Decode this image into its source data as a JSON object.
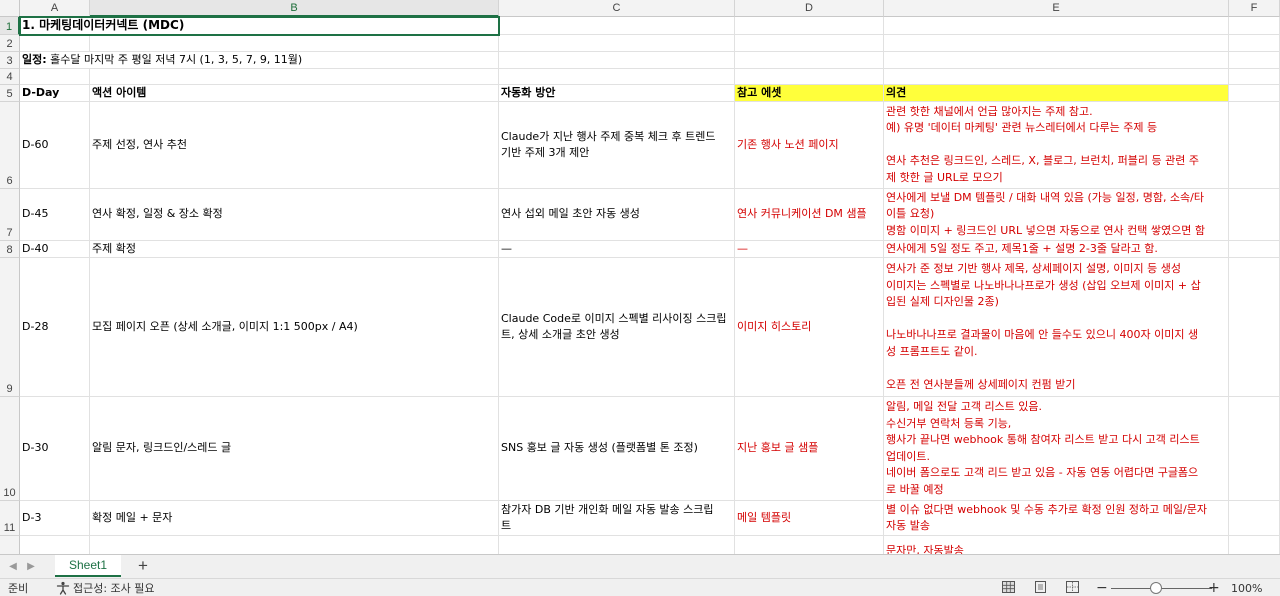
{
  "columns": [
    "A",
    "B",
    "C",
    "D",
    "E",
    "F"
  ],
  "rows": [
    "1",
    "2",
    "3",
    "4",
    "5",
    "6",
    "7",
    "8",
    "9",
    "10",
    "11"
  ],
  "title": "1. 마케팅데이터커넥트 (MDC)",
  "schedule": {
    "label": "일정:",
    "text": " 홀수달 마지막 주 평일 저녁 7시 (1, 3, 5, 7, 9, 11월)"
  },
  "headers": {
    "dday": "D-Day",
    "action": "액션 아이템",
    "automation": "자동화 방안",
    "asset": "참고 에셋",
    "opinion": "의견"
  },
  "data_rows": [
    {
      "dday": "D-60",
      "action": "주제 선정, 연사 추천",
      "automation": "Claude가 지난 행사 주제 중복 체크 후 트렌드\n기반 주제 3개 제안",
      "asset": "기존 행사 노션 페이지",
      "opinion": "관련 핫한 채널에서 언급 많아지는 주제 참고.\n예) 유명 '데이터 마케팅' 관련 뉴스레터에서 다루는 주제 등\n\n연사 추천은 링크드인, 스레드, X, 블로그, 브런치, 퍼블리 등 관련 주\n제 핫한 글 URL로 모으기"
    },
    {
      "dday": "D-45",
      "action": "연사 확정, 일정 & 장소 확정",
      "automation": "연사 섭외 메일 초안 자동 생성",
      "asset": "연사 커뮤니케이션 DM 샘플",
      "opinion": "연사에게 보낼 DM 템플릿 / 대화 내역 있음 (가능 일정, 명함, 소속/타\n이틀 요청)\n명함 이미지 + 링크드인 URL 넣으면 자동으로 연사 컨택 쌓였으면 함"
    },
    {
      "dday": "D-40",
      "action": "주제 확정",
      "automation": "—",
      "asset": "—",
      "opinion": "연사에게 5일 정도 주고, 제목1줄 + 설명 2-3줄 달라고 함."
    },
    {
      "dday": "D-28",
      "action": "모집 페이지 오픈 (상세 소개글, 이미지 1:1 500px / A4)",
      "automation": "Claude Code로 이미지 스펙별 리사이징 스크립\n트, 상세 소개글 초안 생성",
      "asset": "이미지 히스토리",
      "opinion": "연사가 준 정보 기반 행사 제목, 상세페이지 설명, 이미지 등 생성\n이미지는 스펙별로 나노바나나프로가 생성 (삽입 오브제 이미지 + 삽\n입된 실제 디자인물 2종)\n\n나노바나나프로 결과물이 마음에 안 들수도 있으니 400자 이미지 생\n성 프롬프트도 같이.\n\n오픈 전 연사분들께 상세페이지 컨펌 받기"
    },
    {
      "dday": "D-30",
      "action": "알림 문자, 링크드인/스레드 글",
      "automation": "SNS 홍보 글 자동 생성 (플랫폼별 톤 조정)",
      "asset": "지난 홍보 글 샘플",
      "opinion": "알림, 메일 전달 고객 리스트 있음.\n수신거부 연락처 등록 기능,\n행사가 끝나면 webhook 통해 참여자 리스트 받고 다시 고객 리스트\n업데이트.\n네이버 폼으로도 고객 리드 받고 있음 - 자동 연동 어렵다면 구글폼으\n로 바꿀 예정"
    },
    {
      "dday": "D-3",
      "action": "확정 메일 + 문자",
      "automation": "참가자 DB 기반 개인화 메일 자동 발송 스크립\n트",
      "asset": "메일 템플릿",
      "opinion": "별 이슈 없다면 webhook 및 수동 추가로 확정 인원 정하고 메일/문자\n자동 발송"
    },
    {
      "dday": "",
      "action": "",
      "automation": "",
      "asset": "",
      "opinion": "문자만, 자동발송"
    }
  ],
  "sheet_tab": "Sheet1",
  "add_sheet": "+",
  "status": {
    "ready": "준비",
    "accessibility": "접근성: 조사 필요",
    "zoom": "100%",
    "zoom_level": 100
  },
  "colors": {
    "accent": "#1e7145",
    "red_text": "#d40000",
    "highlight": "#ffff3b"
  }
}
